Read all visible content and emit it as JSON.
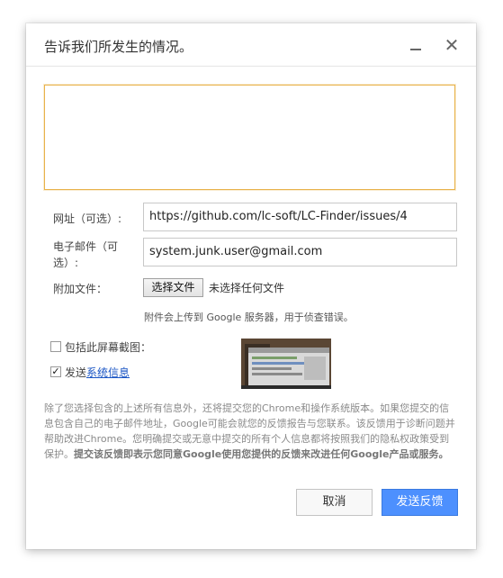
{
  "dialog": {
    "title": "告诉我们所发生的情况。",
    "minimize_icon": "minimize-icon",
    "close_icon": "close-icon",
    "close_glyph": "✕"
  },
  "form": {
    "description_value": "",
    "url_label": "网址（可选）:",
    "url_value": "https://github.com/lc-soft/LC-Finder/issues/4",
    "email_label_line1": "电子邮件（可",
    "email_label_line2": "选）:",
    "email_value": "system.junk.user@gmail.com",
    "attach_label": "附加文件：",
    "choose_file_button": "选择文件",
    "no_file_text": "未选择任何文件",
    "upload_note": "附件会上传到 Google 服务器，用于侦查错误。",
    "screenshot_checkbox": {
      "checked": false,
      "label": "包括此屏幕截图："
    },
    "sysinfo_checkbox": {
      "checked": true,
      "label_prefix": "发送",
      "link": "系统信息"
    }
  },
  "legal": {
    "text": "除了您选择包含的上述所有信息外，还将提交您的Chrome和操作系统版本。如果您提交的信息包含自己的电子邮件地址，Google可能会就您的反馈报告与您联系。该反馈用于诊断问题并帮助改进Chrome。您明确提交或无意中提交的所有个人信息都将按照我们的隐私权政策受到保护。",
    "bold": "提交该反馈即表示您同意Google使用您提供的反馈来改进任何Google产品或服务。"
  },
  "buttons": {
    "cancel": "取消",
    "send": "发送反馈"
  },
  "colors": {
    "accent": "#4d90fe",
    "focus_border": "#e8b24a",
    "link": "#1a55c4"
  }
}
